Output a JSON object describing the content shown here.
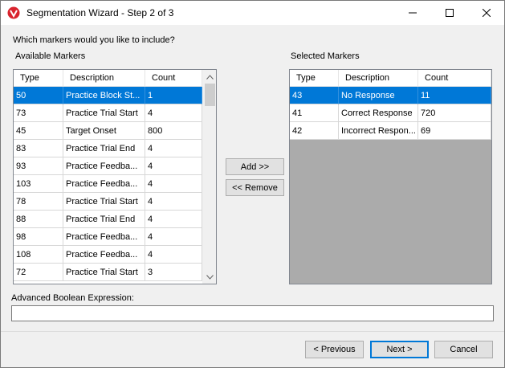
{
  "window": {
    "title": "Segmentation Wizard - Step 2 of 3",
    "icon": "app-logo-icon"
  },
  "prompt": "Which markers would you like to include?",
  "available": {
    "label": "Available Markers",
    "columns": [
      "Type",
      "Description",
      "Count"
    ],
    "rows": [
      {
        "type": "50",
        "description": "Practice Block St...",
        "count": "1",
        "selected": true
      },
      {
        "type": "73",
        "description": "Practice Trial Start",
        "count": "4"
      },
      {
        "type": "45",
        "description": "Target Onset",
        "count": "800"
      },
      {
        "type": "83",
        "description": "Practice Trial End",
        "count": "4"
      },
      {
        "type": "93",
        "description": "Practice Feedba...",
        "count": "4"
      },
      {
        "type": "103",
        "description": "Practice Feedba...",
        "count": "4"
      },
      {
        "type": "78",
        "description": "Practice Trial Start",
        "count": "4"
      },
      {
        "type": "88",
        "description": "Practice Trial End",
        "count": "4"
      },
      {
        "type": "98",
        "description": "Practice Feedba...",
        "count": "4"
      },
      {
        "type": "108",
        "description": "Practice Feedba...",
        "count": "4"
      },
      {
        "type": "72",
        "description": "Practice Trial Start",
        "count": "3"
      }
    ]
  },
  "selected": {
    "label": "Selected Markers",
    "columns": [
      "Type",
      "Description",
      "Count"
    ],
    "rows": [
      {
        "type": "43",
        "description": "No Response",
        "count": "11",
        "selected": true
      },
      {
        "type": "41",
        "description": "Correct Response",
        "count": "720"
      },
      {
        "type": "42",
        "description": "Incorrect Respon...",
        "count": "69"
      }
    ]
  },
  "middle_buttons": {
    "add": "Add >>",
    "remove": "<< Remove"
  },
  "boolean": {
    "label": "Advanced Boolean Expression:",
    "value": ""
  },
  "footer": {
    "previous": "< Previous",
    "next": "Next >",
    "cancel": "Cancel"
  },
  "colors": {
    "selection": "#0078d7",
    "dialog_bg": "#f0f0f0",
    "empty_list_bg": "#ababab"
  }
}
